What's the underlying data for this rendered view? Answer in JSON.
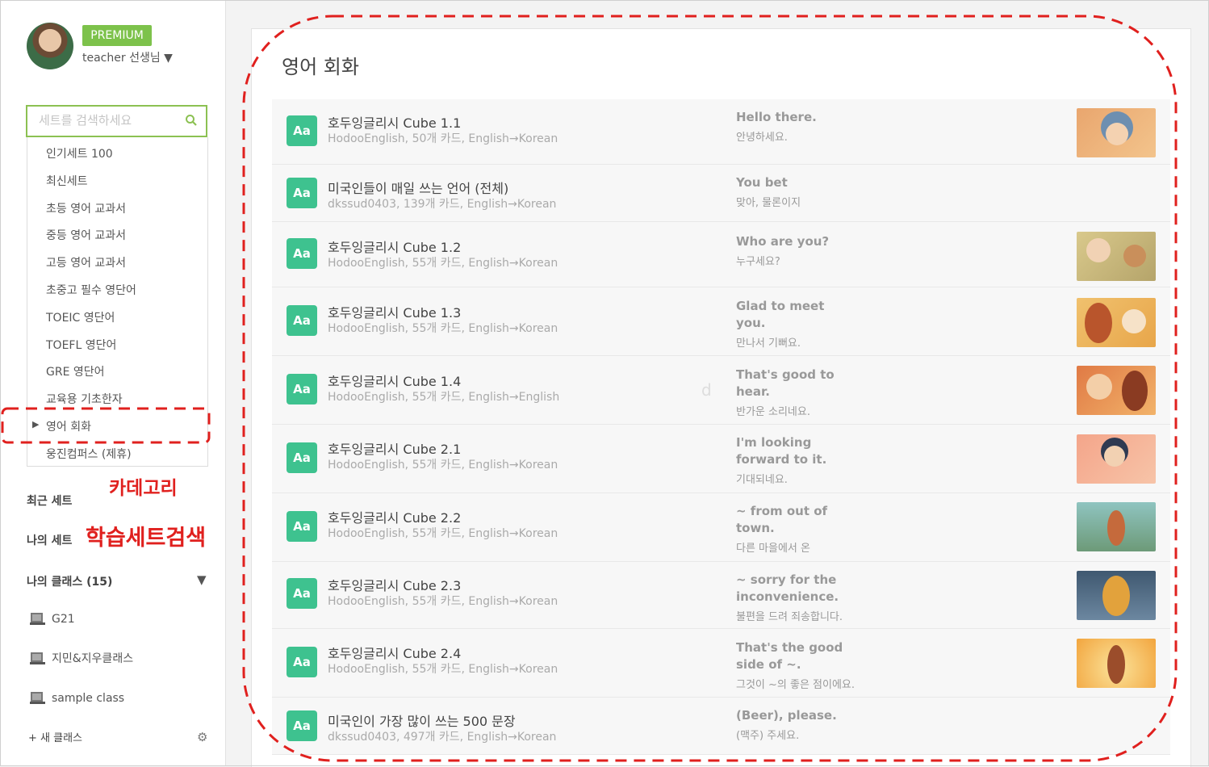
{
  "profile": {
    "badge": "PREMIUM",
    "username": "teacher 선생님 ▼"
  },
  "search": {
    "placeholder": "세트를 검색하세요"
  },
  "categories": [
    "인기세트 100",
    "최신세트",
    "초등 영어 교과서",
    "중등 영어 교과서",
    "고등 영어 교과서",
    "초중고 필수 영단어",
    "TOEIC 영단어",
    "TOEFL 영단어",
    "GRE 영단어",
    "교육용 기초한자",
    "영어 회화",
    "웅진컴퍼스 (제휴)"
  ],
  "selected_category_arrow": "▶",
  "sections": {
    "recent": "최근 세트",
    "my_sets": "나의 세트",
    "my_classes": "나의 클래스 (15)",
    "toggle": "▼"
  },
  "classes": [
    "G21",
    "지민&지우클래스",
    "sample class"
  ],
  "new_class": "+ 새 클래스",
  "annotations": {
    "category": "카데고리",
    "search": "학습세트검색"
  },
  "main": {
    "title": "영어 회화",
    "stray_char": "d",
    "sets": [
      {
        "icon": "Aa",
        "title": "호두잉글리시 Cube 1.1",
        "meta": "HodooEnglish, 50개 카드, English→Korean",
        "en": "Hello there.",
        "ko": "안녕하세요."
      },
      {
        "icon": "Aa",
        "title": "미국인들이 매일 쓰는 언어 (전체)",
        "meta": "dkssud0403, 139개 카드, English→Korean",
        "en": "You bet",
        "ko": "맞아, 물론이지"
      },
      {
        "icon": "Aa",
        "title": "호두잉글리시 Cube 1.2",
        "meta": "HodooEnglish, 55개 카드, English→Korean",
        "en": "Who are you?",
        "ko": "누구세요?"
      },
      {
        "icon": "Aa",
        "title": "호두잉글리시 Cube 1.3",
        "meta": "HodooEnglish, 55개 카드, English→Korean",
        "en": "Glad to meet you.",
        "ko": "만나서 기뻐요."
      },
      {
        "icon": "Aa",
        "title": "호두잉글리시 Cube 1.4",
        "meta": "HodooEnglish, 55개 카드, English→English",
        "en": "That's good to hear.",
        "ko": "반가운 소리네요."
      },
      {
        "icon": "Aa",
        "title": "호두잉글리시 Cube 2.1",
        "meta": "HodooEnglish, 55개 카드, English→Korean",
        "en": "I'm looking forward to it.",
        "ko": "기대되네요."
      },
      {
        "icon": "Aa",
        "title": "호두잉글리시 Cube 2.2",
        "meta": "HodooEnglish, 55개 카드, English→Korean",
        "en": "~ from out of town.",
        "ko": "다른 마을에서 온"
      },
      {
        "icon": "Aa",
        "title": "호두잉글리시 Cube 2.3",
        "meta": "HodooEnglish, 55개 카드, English→Korean",
        "en": "~ sorry for the inconvenience.",
        "ko": "불편을 드려 죄송합니다."
      },
      {
        "icon": "Aa",
        "title": "호두잉글리시 Cube 2.4",
        "meta": "HodooEnglish, 55개 카드, English→Korean",
        "en": "That's the good side of ~.",
        "ko": "그것이 ~의 좋은 점이에요."
      },
      {
        "icon": "Aa",
        "title": "미국인이 가장 많이 쓰는 500 문장",
        "meta": "dkssud0403, 497개 카드, English→Korean",
        "en": "(Beer), please.",
        "ko": "(맥주) 주세요."
      }
    ]
  },
  "colors": {
    "accent_green": "#8cc152",
    "premium": "#7dc24b",
    "icon_teal": "#3ec28f",
    "annotation_red": "#e0201e"
  }
}
